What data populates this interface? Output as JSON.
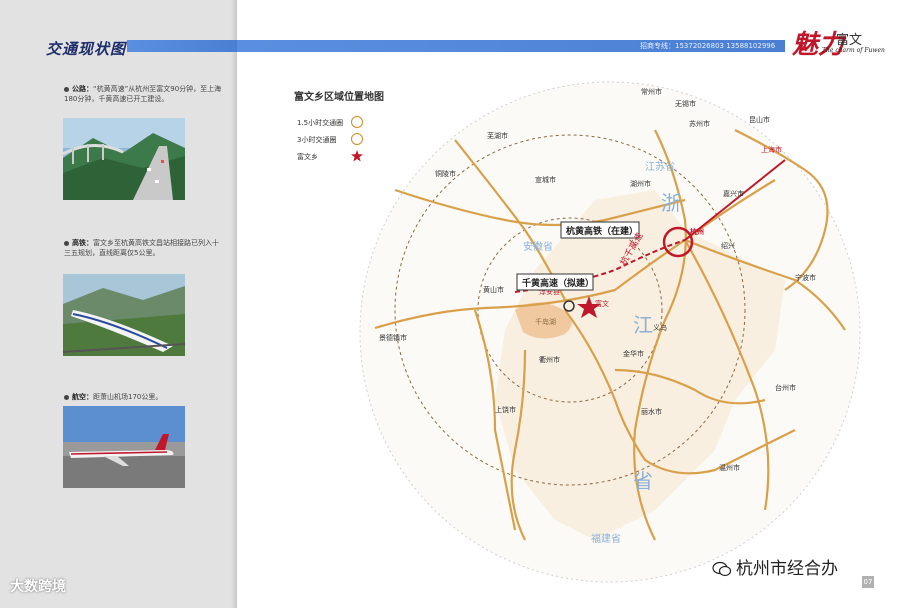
{
  "header": {
    "title": "交通现状图",
    "contact": "招商专线：15372026803  13588102996",
    "brand_glyph": "魅力",
    "brand_name": "富文",
    "brand_sub": "The charm of Fuwen"
  },
  "sections": [
    {
      "label": "公路：",
      "text": "“杭黄高速”从杭州至富文90分钟，至上海180分钟，千黄高速已开工建设。"
    },
    {
      "label": "高铁：",
      "text": "富文乡至杭黄高铁文昌站相接路已列入十三五规划，直线距离仅5公里。"
    },
    {
      "label": "航空：",
      "text": "距萧山机场170公里。"
    }
  ],
  "map": {
    "title": "富文乡区域位置地图",
    "legend": [
      {
        "label": "1.5小时交通圈"
      },
      {
        "label": "3小时交通圈"
      },
      {
        "label": "富文乡"
      }
    ],
    "labels": {
      "hangzhou": "杭州",
      "shanghai": "上海市",
      "wuxi": "无锡市",
      "changzhou": "常州市",
      "suzhou": "苏州市",
      "kunshan": "昆山市",
      "huzhou": "湖州市",
      "jiaxing": "嘉兴市",
      "wuhu": "芜湖市",
      "xuancheng": "宣城市",
      "tongling": "铜陵市",
      "huangshan": "黄山市",
      "jingdezhen": "景德镇市",
      "quzhou": "衢州市",
      "jinhua": "金华市",
      "lishui": "丽水市",
      "wenzhou": "温州市",
      "taizhou": "台州市",
      "ningbo": "宁波市",
      "shangrao": "上饶市",
      "shaoxing": "绍兴",
      "yiwu": "义乌",
      "chunan": "淳安县",
      "fuwen": "富文",
      "jiangsu": "江苏省",
      "anhui": "安徽省",
      "fujian": "福建省",
      "zhe": "浙",
      "jiang": "江",
      "sheng": "省",
      "hsr": "杭黄高铁（在建）",
      "expressway": "千黄高速（拟建）",
      "hang_qian_gao_su": "杭千高速",
      "lake": "千岛湖"
    }
  },
  "footer": {
    "page": "07",
    "watermark_left": "大数跨境",
    "watermark_right": "杭州市经合办"
  },
  "colors": {
    "title_bar": "#3f67c6",
    "road": "#d9a04a",
    "star": "#c0182a",
    "province_text": "#8bb0d6"
  }
}
